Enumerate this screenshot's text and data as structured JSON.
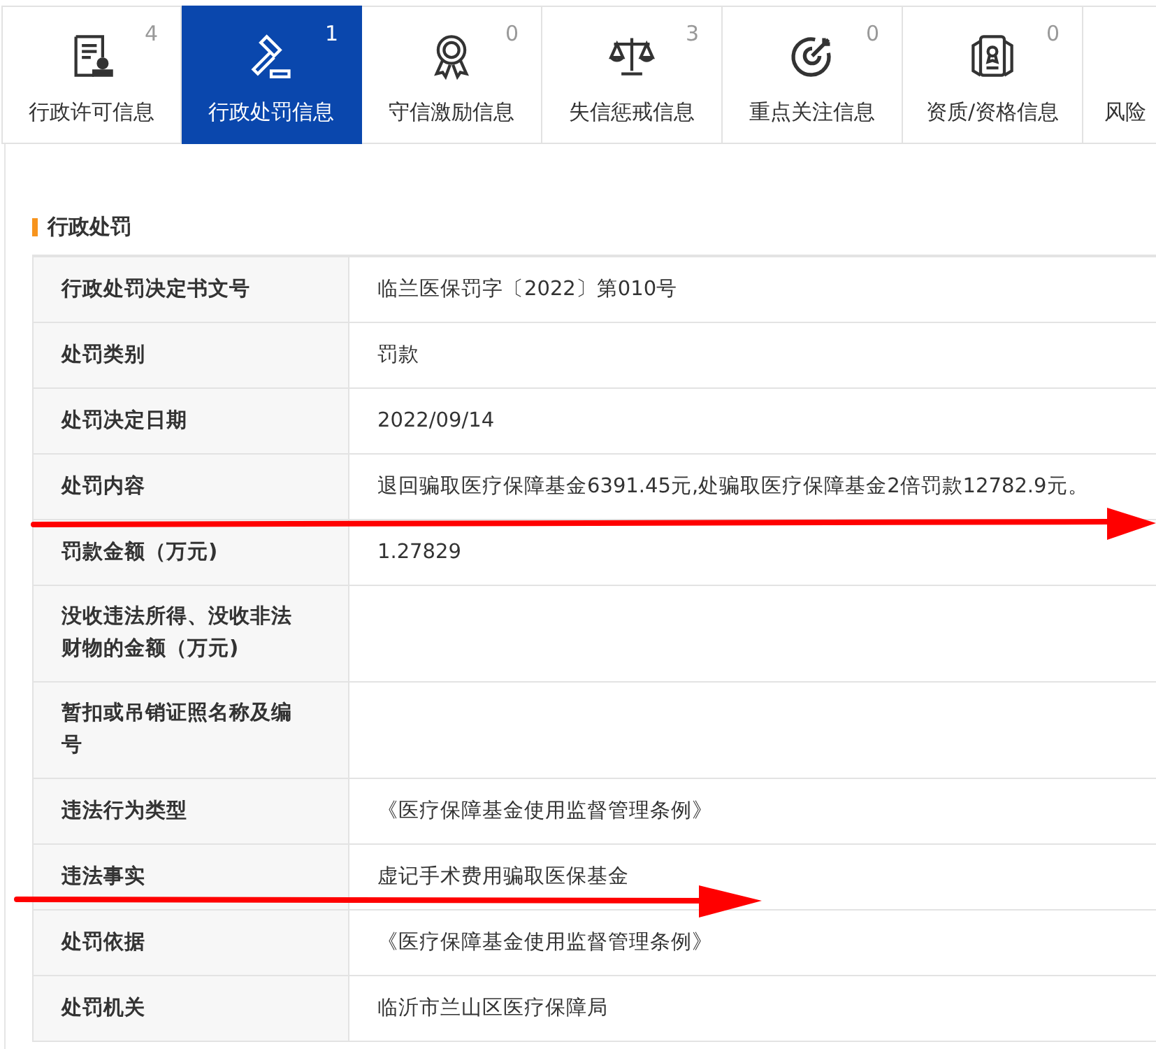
{
  "tabs": [
    {
      "kind": "license",
      "label": "行政许可信息",
      "count": "4",
      "selected": false
    },
    {
      "kind": "gavel",
      "label": "行政处罚信息",
      "count": "1",
      "selected": true
    },
    {
      "kind": "medal",
      "label": "守信激励信息",
      "count": "0",
      "selected": false
    },
    {
      "kind": "scale",
      "label": "失信惩戒信息",
      "count": "3",
      "selected": false
    },
    {
      "kind": "target",
      "label": "重点关注信息",
      "count": "0",
      "selected": false
    },
    {
      "kind": "certificate",
      "label": "资质/资格信息",
      "count": "0",
      "selected": false
    },
    {
      "kind": "cut",
      "label": "风险",
      "selected": false
    }
  ],
  "section_title": "行政处罚",
  "rows": [
    {
      "label": "行政处罚决定书文号",
      "value": "临兰医保罚字〔2022〕第010号"
    },
    {
      "label": "处罚类别",
      "value": "罚款"
    },
    {
      "label": "处罚决定日期",
      "value": "2022/09/14"
    },
    {
      "label": "处罚内容",
      "value": "退回骗取医疗保障基金6391.45元,处骗取医疗保障基金2倍罚款12782.9元。"
    },
    {
      "label": "罚款金额（万元)",
      "value": "1.27829"
    },
    {
      "label": "没收违法所得、没收非法财物的金额（万元)"
    },
    {
      "label": "暂扣或吊销证照名称及编号"
    },
    {
      "label": "违法行为类型",
      "value": "《医疗保障基金使用监督管理条例》"
    },
    {
      "label": "违法事实",
      "value": "虚记手术费用骗取医保基金"
    },
    {
      "label": "处罚依据",
      "value": "《医疗保障基金使用监督管理条例》"
    },
    {
      "label": "处罚机关",
      "value": "临沂市兰山区医疗保障局"
    }
  ]
}
